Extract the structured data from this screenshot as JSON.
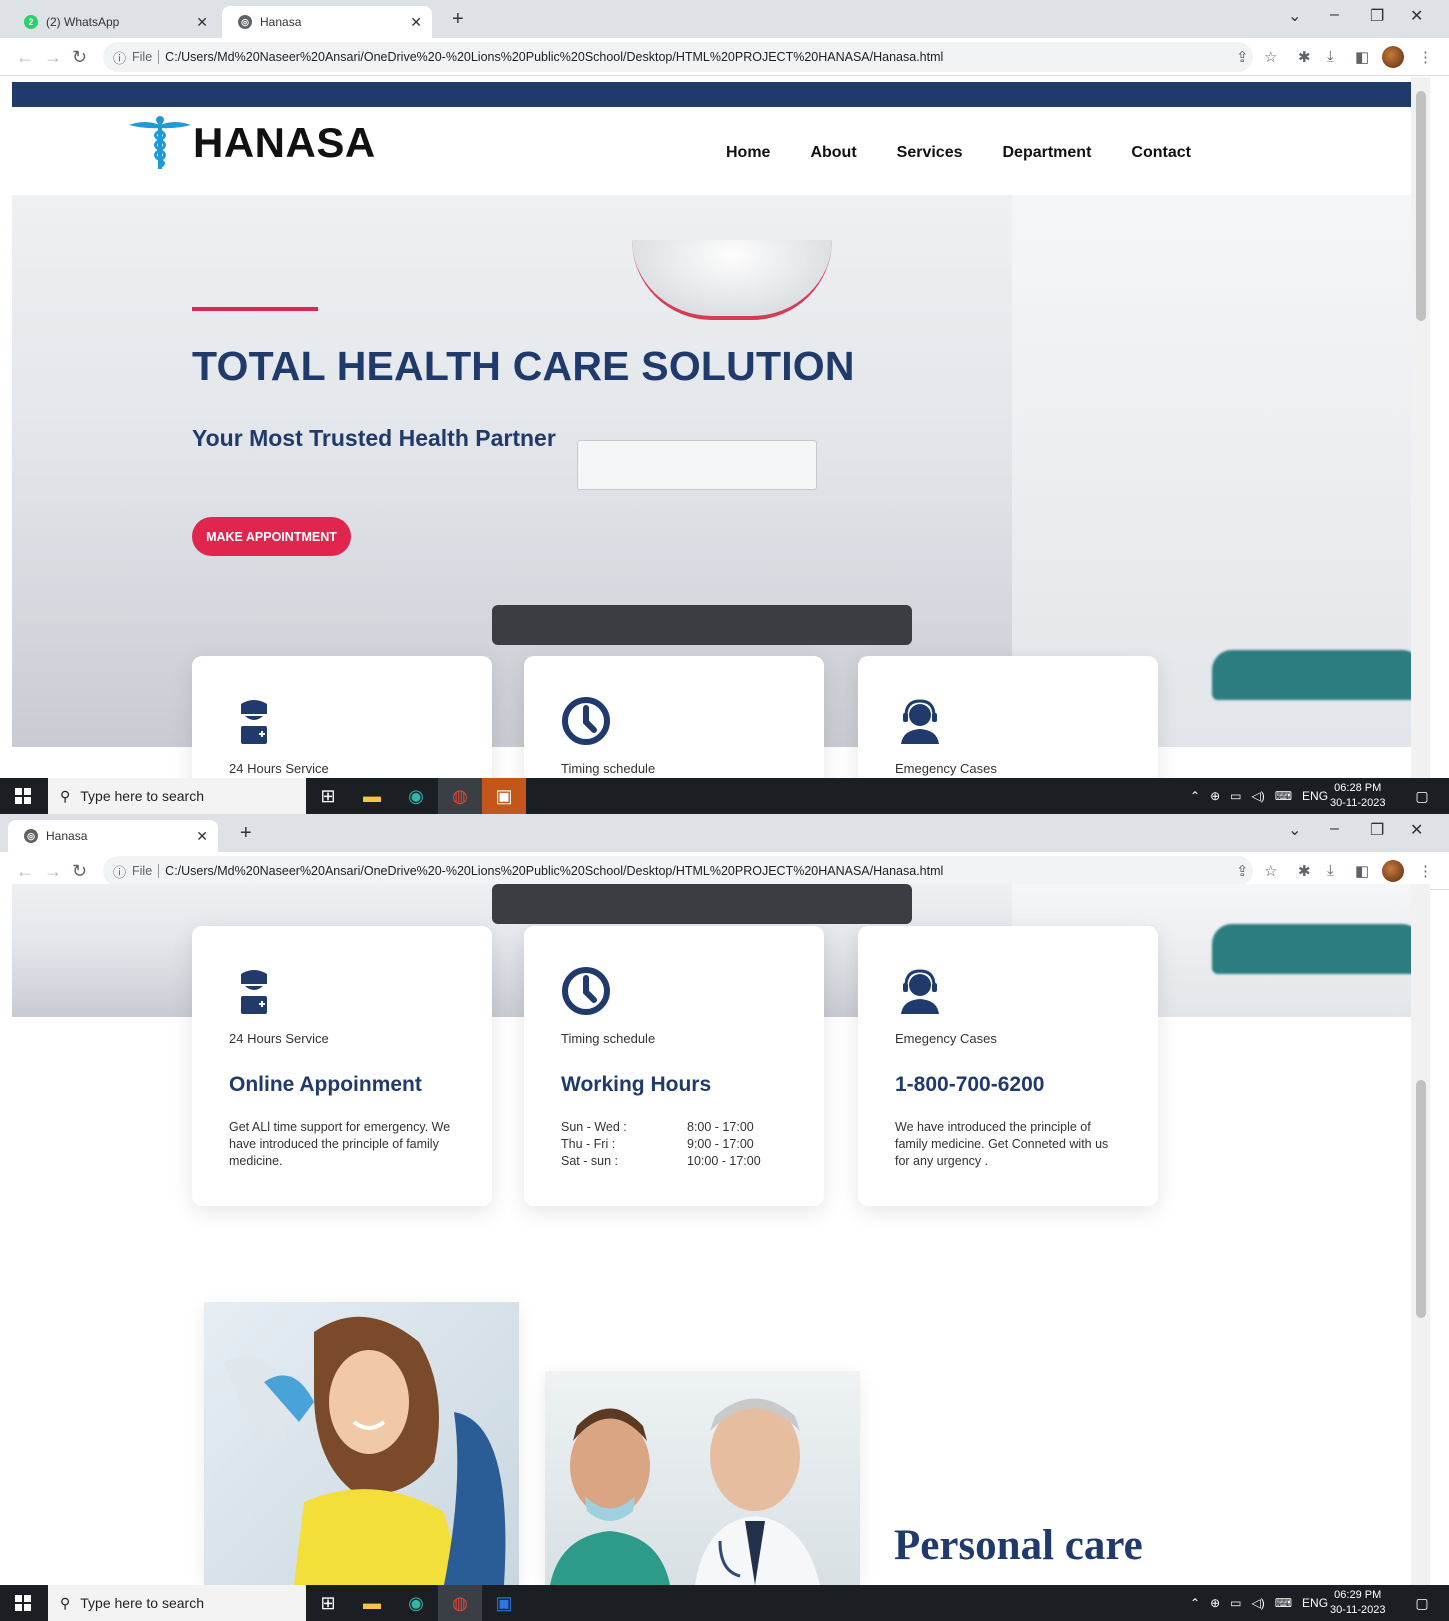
{
  "browser": {
    "tabs_top": [
      {
        "title": "(2) WhatsApp",
        "badge": "2"
      },
      {
        "title": "Hanasa"
      }
    ],
    "tabs_bottom": [
      {
        "title": "Hanasa"
      }
    ],
    "file_label": "File",
    "url": "C:/Users/Md%20Naseer%20Ansari/OneDrive%20-%20Lions%20Public%20School/Desktop/HTML%20PROJECT%20HANASA/Hanasa.html"
  },
  "site": {
    "logo": "HANASA",
    "nav": [
      "Home",
      "About",
      "Services",
      "Department",
      "Contact"
    ],
    "hero": {
      "title": "TOTAL HEALTH CARE SOLUTION",
      "subtitle": "Your Most Trusted Health Partner",
      "cta": "MAKE APPOINTMENT"
    },
    "cards": [
      {
        "tag": "24 Hours Service",
        "title": "Online Appoinment",
        "desc": "Get ALl time support for emergency. We have introduced the principle of family medicine.",
        "icon": "doctor-icon"
      },
      {
        "tag": "Timing schedule",
        "title": "Working Hours",
        "icon": "clock-icon",
        "hours": [
          {
            "day": "Sun - Wed :",
            "time": "8:00 - 17:00"
          },
          {
            "day": "Thu - Fri :",
            "time": "9:00 - 17:00"
          },
          {
            "day": "Sat - sun :",
            "time": "10:00 - 17:00"
          }
        ]
      },
      {
        "tag": "Emegency Cases",
        "title": "1-800-700-6200",
        "desc": "We have introduced the principle of family medicine. Get Conneted with us for any urgency .",
        "icon": "headset-icon"
      }
    ],
    "personal_care": "Personal care"
  },
  "taskbar": {
    "search_placeholder": "Type here to search",
    "lang": "ENG",
    "time_top": "06:28 PM",
    "time_bottom": "06:29 PM",
    "date": "30-11-2023"
  },
  "colors": {
    "navy": "#1f3a6b",
    "accent": "#e0254f"
  }
}
